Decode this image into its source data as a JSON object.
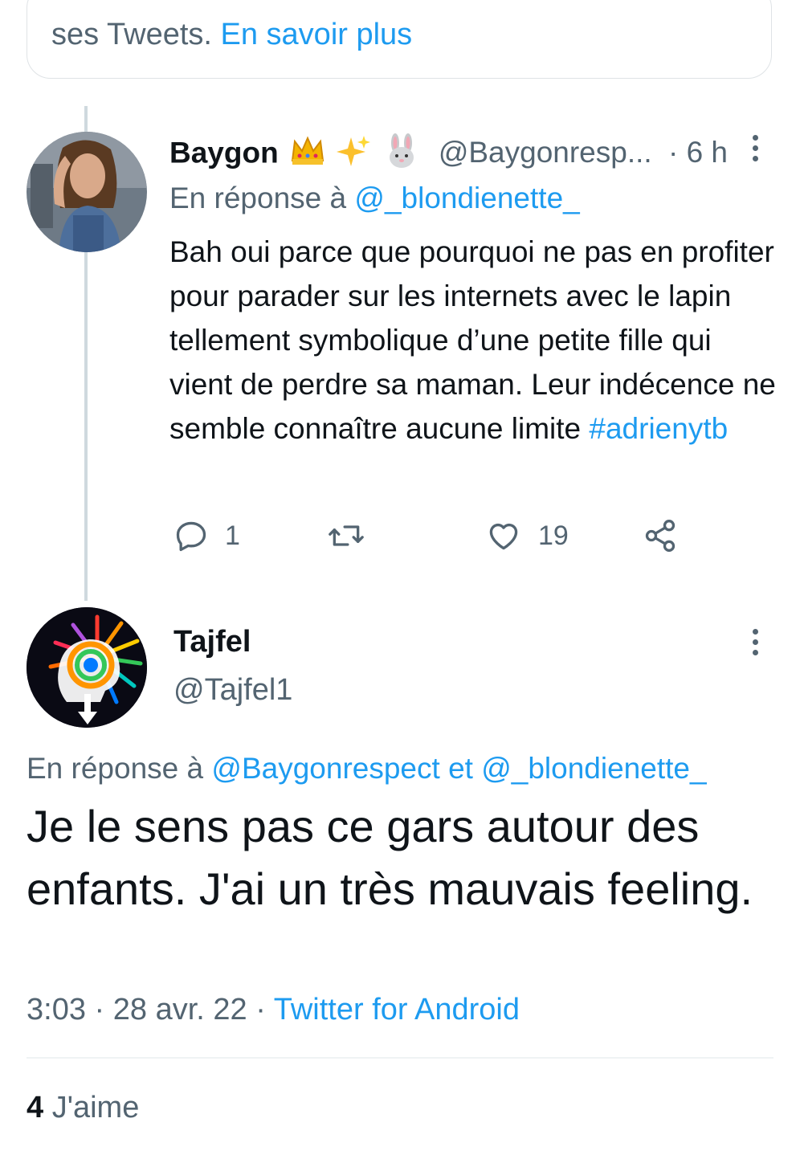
{
  "notice": {
    "text": "ses Tweets.",
    "link": "En savoir plus"
  },
  "tweet1": {
    "name": "Baygon",
    "emojis": [
      "crown-emoji",
      "sparkles-emoji",
      "rabbit-emoji"
    ],
    "handle": "@Baygonresp...",
    "separator": "·",
    "time": "6 h",
    "reply_prefix": "En réponse à",
    "reply_to": "@_blondienette_",
    "body": "Bah oui parce que pourquoi ne pas en profiter pour parader sur les internets avec le lapin tellement symbolique d’une petite fille qui vient de perdre sa maman. Leur indécence ne semble connaître aucune limite",
    "hashtag": "#adrienytb",
    "actions": {
      "reply_count": "1",
      "retweet_count": "",
      "like_count": "19"
    }
  },
  "tweet2": {
    "name": "Tajfel",
    "handle": "@Tajfel1",
    "reply_prefix": "En réponse à",
    "reply_to_1": "@Baygonrespect",
    "reply_conj": "et",
    "reply_to_2": "@_blondienette_",
    "body": "Je le sens pas ce gars autour des enfants. J'ai un très mauvais feeling.",
    "time": "3:03",
    "sep": "·",
    "date": "28 avr. 22",
    "source": "Twitter for Android",
    "likes_count": "4",
    "likes_label": "J'aime"
  },
  "colors": {
    "accent": "#1d9bf0",
    "secondary_text": "#536471",
    "primary_text": "#0f1419",
    "thread_line": "#cfd9de"
  }
}
